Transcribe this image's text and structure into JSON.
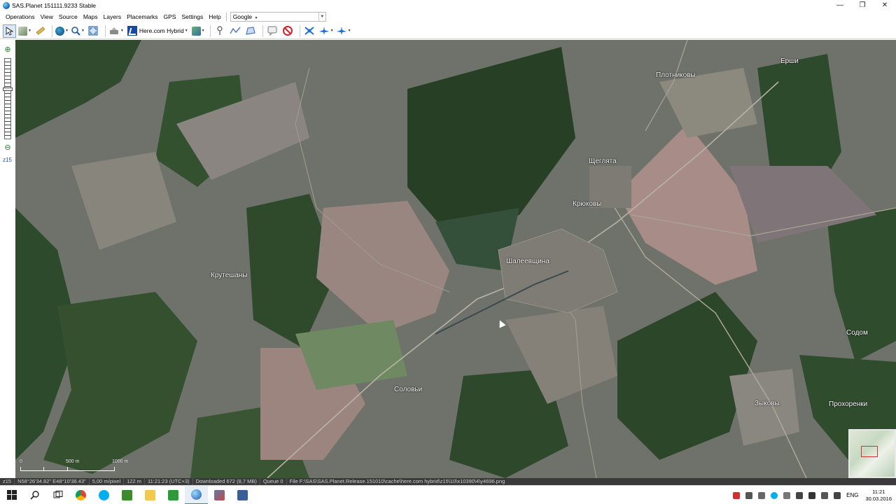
{
  "window": {
    "title": "SAS.Planet 151111.9233 Stable",
    "controls": {
      "minimize": "—",
      "maximize": "❐",
      "close": "✕"
    }
  },
  "menu": {
    "items": [
      "Operations",
      "View",
      "Source",
      "Maps",
      "Layers",
      "Placemarks",
      "GPS",
      "Settings",
      "Help"
    ],
    "google_label": "Google",
    "search_combo_value": ""
  },
  "toolbar": {
    "map_type_label": "Here.com Hybrid",
    "icons": [
      "select-arrow-icon",
      "layers-icon",
      "ruler-icon",
      "globe-icon",
      "zoom-icon",
      "fullscreen-icon",
      "gps-icon",
      "map-type-icon",
      "edit-layer-icon",
      "placemark-icon",
      "route-icon",
      "polygon-icon",
      "balloon-icon",
      "stop-icon",
      "satellite-icon",
      "plane-icon",
      "plane2-icon"
    ]
  },
  "zoombar": {
    "zoom_level_label": "z15"
  },
  "map": {
    "places": [
      {
        "name": "Ерши"
      },
      {
        "name": "Плотниковы"
      },
      {
        "name": "Щеглята"
      },
      {
        "name": "Крюковы"
      },
      {
        "name": "Шалеевщина"
      },
      {
        "name": "Крутешаны"
      },
      {
        "name": "Содом"
      },
      {
        "name": "Соловьи"
      },
      {
        "name": "Зыковы"
      },
      {
        "name": "Прохоренки"
      }
    ],
    "scale_labels": {
      "zero": "0",
      "half": "500 m",
      "full": "1000 m"
    }
  },
  "status": {
    "zoom": "z15",
    "coords": "N58°26'34.82\" E48°10'38.43\"",
    "resolution": "5,00 m/pixel",
    "altitude": "122 m",
    "time": "11:21:23 (UTC+3)",
    "downloaded": "Downloaded 672 (8,7 MB)",
    "queue": "Queue 0",
    "file": "File F:\\SAS\\SAS.Planet.Release.151010\\cache\\here.com hybrid\\z15\\10\\x10390\\4\\y4696.png"
  },
  "taskbar": {
    "apps": [
      "windows-start-icon",
      "search-icon",
      "task-view-icon",
      "chrome-icon",
      "skype-icon",
      "camtasia-icon",
      "file-explorer-icon",
      "camtasia-recorder-icon",
      "sasplanet-icon",
      "app-icon-2",
      "app-icon-3"
    ],
    "tray_lang": "ENG",
    "clock_time": "11:21",
    "clock_date": "30.03.2016"
  },
  "colors": {
    "map_base": "#6b6f66",
    "forest": "#2f4b2c",
    "field_pink": "#a48a85",
    "statusbar_bg": "#3a3a3a",
    "selected_tool": "#dce8f6"
  }
}
